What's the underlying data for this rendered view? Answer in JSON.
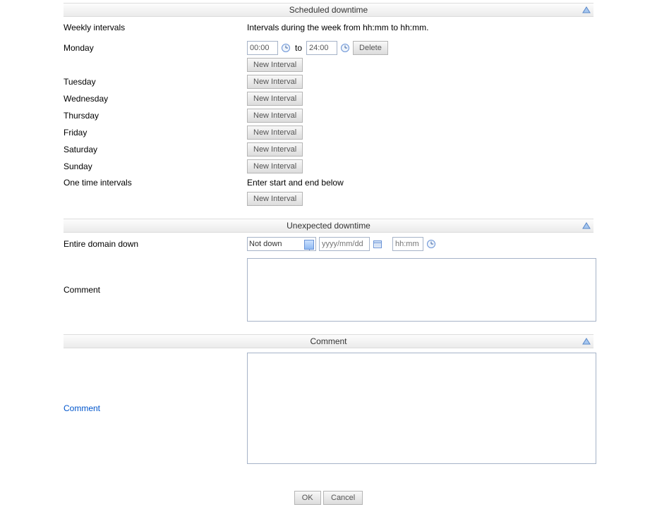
{
  "sections": {
    "scheduled": {
      "title": "Scheduled downtime"
    },
    "unexpected": {
      "title": "Unexpected downtime"
    },
    "comment": {
      "title": "Comment"
    }
  },
  "scheduled": {
    "weekly_label": "Weekly intervals",
    "weekly_desc": "Intervals during the week from hh:mm to hh:mm.",
    "days": {
      "mon": "Monday",
      "tue": "Tuesday",
      "wed": "Wednesday",
      "thu": "Thursday",
      "fri": "Friday",
      "sat": "Saturday",
      "sun": "Sunday"
    },
    "monday_interval": {
      "from": "00:00",
      "to_label": "to",
      "to": "24:00"
    },
    "delete_label": "Delete",
    "new_interval_label": "New Interval",
    "onetime_label": "One time intervals",
    "onetime_desc": "Enter start and end below"
  },
  "unexpected": {
    "domain_label": "Entire domain down",
    "status_value": "Not down",
    "date_placeholder": "yyyy/mm/dd",
    "time_placeholder": "hh:mm",
    "comment_label": "Comment"
  },
  "comment_section": {
    "comment_label": "Comment"
  },
  "footer": {
    "ok": "OK",
    "cancel": "Cancel"
  }
}
